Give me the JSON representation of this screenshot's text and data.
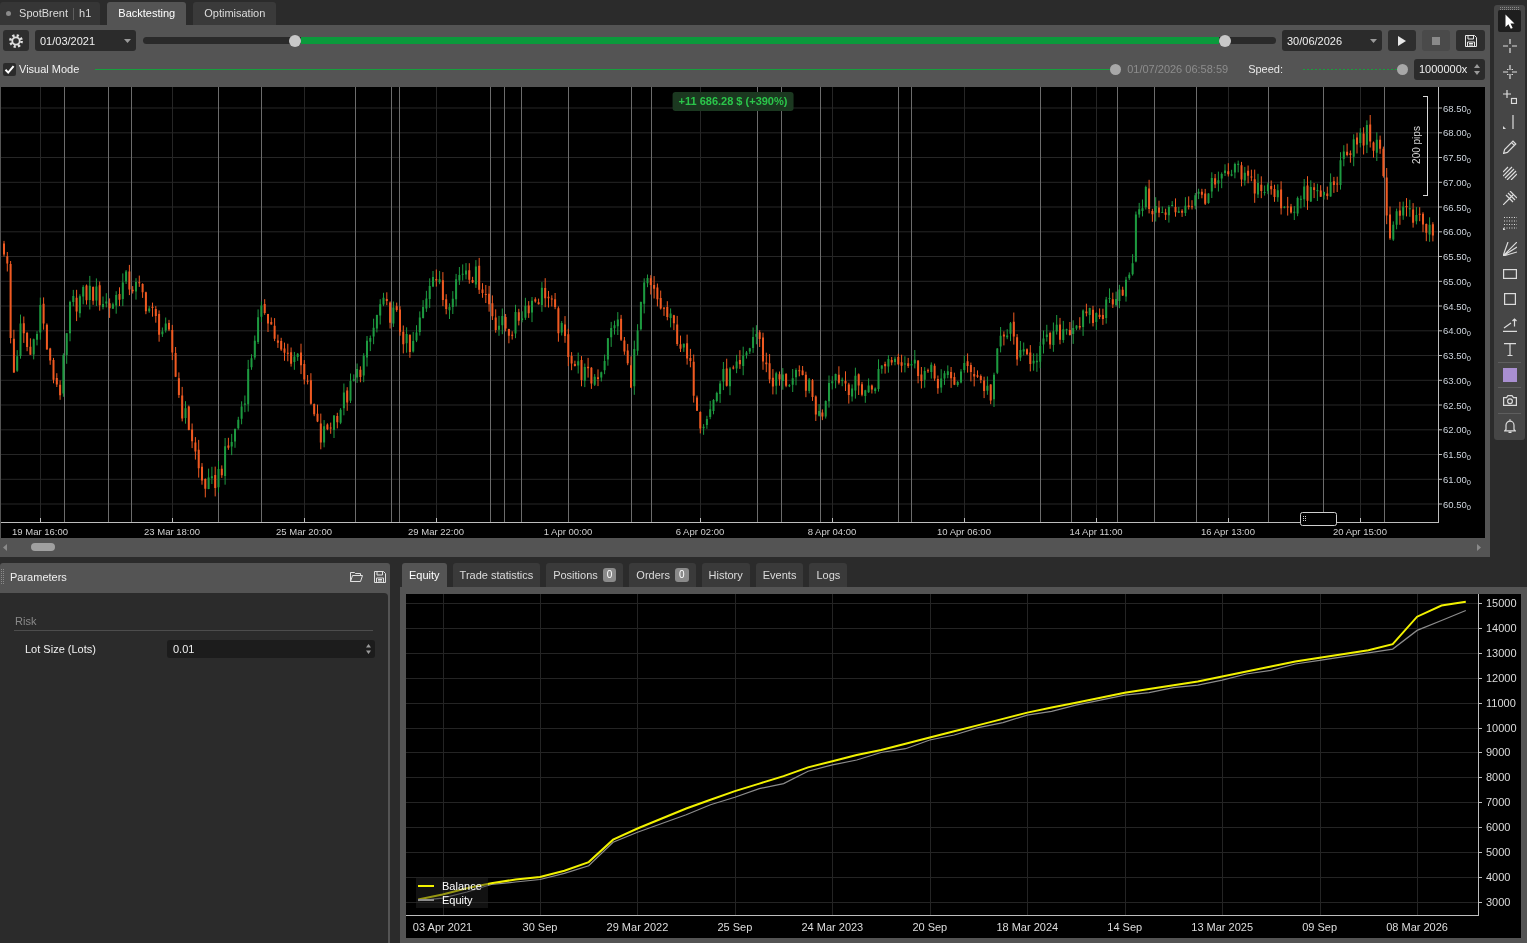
{
  "symbol_tab": {
    "symbol": "SpotBrent",
    "timeframe": "h1"
  },
  "mode_tabs": [
    {
      "label": "Backtesting",
      "selected": true
    },
    {
      "label": "Optimisation",
      "selected": false
    }
  ],
  "period": {
    "start_date": "01/03/2021",
    "end_date": "30/06/2026",
    "start": {
      "level": 0.134
    },
    "end": {
      "level": 0.955
    }
  },
  "playback_buttons": [
    {
      "kind": "play",
      "disabled": false
    },
    {
      "kind": "stop",
      "disabled": true
    },
    {
      "kind": "save",
      "disabled": false
    }
  ],
  "visual_mode": {
    "label": "Visual Mode",
    "checked": true
  },
  "progress": {
    "level": 1,
    "time": "01/07/2026 06:58:59"
  },
  "speed": {
    "label": "Speed:",
    "level": 1,
    "value": "1000000x"
  },
  "price_chart": {
    "profit": "+11 686.28 $ (+390%)",
    "ruler": "200 pips",
    "price_labels": [
      "68.50$_{0}$",
      "68.00$_{0}$",
      "67.50$_{0}$",
      "67.00$_{0}$",
      "66.50$_{0}$",
      "66.00$_{0}$",
      "65.50$_{0}$",
      "65.00$_{0}$",
      "64.50$_{0}$",
      "64.00$_{0}$",
      "63.50$_{0}$",
      "63.00$_{0}$",
      "62.50$_{0}$",
      "62.00$_{0}$",
      "61.50$_{0}$",
      "61.00$_{0}$",
      "60.50$_{0}$"
    ],
    "time_labels": [
      "19 Mar 16:00",
      "23 Mar 18:00",
      "25 Mar 20:00",
      "29 Mar 22:00",
      "1 Apr 00:00",
      "6 Apr 02:00",
      "8 Apr 04:00",
      "10 Apr 06:00",
      "14 Apr 11:00",
      "16 Apr 13:00",
      "20 Apr 15:00"
    ]
  },
  "tool_groups": [
    {
      "tools": [
        {
          "kind": "pointer",
          "selected": true
        },
        {
          "kind": "crosshair",
          "selected": false
        },
        {
          "kind": "target",
          "selected": false
        },
        {
          "kind": "hline",
          "selected": false
        },
        {
          "kind": "vline",
          "selected": false
        },
        {
          "kind": "pencil",
          "selected": false
        },
        {
          "kind": "brush",
          "selected": false
        },
        {
          "kind": "pitchfork",
          "selected": false
        },
        {
          "kind": "fibonacci",
          "selected": false
        },
        {
          "kind": "fan",
          "selected": false
        },
        {
          "kind": "rectangle",
          "selected": false
        },
        {
          "kind": "square",
          "selected": false
        },
        {
          "kind": "measure",
          "selected": false
        },
        {
          "kind": "text",
          "selected": false
        }
      ]
    },
    {
      "tools": [
        {
          "kind": "color",
          "color": "#a98fd1",
          "selected": false
        }
      ]
    },
    {
      "tools": [
        {
          "kind": "camera",
          "selected": false
        }
      ]
    },
    {
      "tools": [
        {
          "kind": "alert",
          "selected": false
        }
      ]
    }
  ],
  "parameters": {
    "title": "Parameters",
    "groups": [
      {
        "name": "Risk",
        "fields": [
          {
            "label": "Lot Size (Lots)",
            "value": "0.01"
          }
        ]
      }
    ]
  },
  "result_tabs": [
    {
      "label": "Equity",
      "selected": true
    },
    {
      "label": "Trade statistics",
      "selected": false
    },
    {
      "label": "Positions",
      "count": "0",
      "selected": false
    },
    {
      "label": "Orders",
      "count": "0",
      "selected": false
    },
    {
      "label": "History",
      "selected": false
    },
    {
      "label": "Events",
      "selected": false
    },
    {
      "label": "Logs",
      "selected": false
    }
  ],
  "equity_chart": {
    "chart_data": {
      "type": "line",
      "grid": true,
      "legend": "lower left",
      "categories": [
        null,
        "03 Apr 2021",
        null,
        null,
        null,
        "30 Sep",
        null,
        null,
        null,
        "29 Mar 2022",
        null,
        null,
        null,
        "25 Sep",
        null,
        null,
        null,
        "24 Mar 2023",
        null,
        null,
        null,
        "20 Sep",
        null,
        null,
        null,
        "18 Mar 2024",
        null,
        null,
        null,
        "14 Sep",
        null,
        null,
        null,
        "13 Mar 2025",
        null,
        null,
        null,
        "09 Sep",
        null,
        null,
        null,
        "08 Mar 2026",
        null,
        null
      ],
      "ylim": [
        2476,
        15362
      ],
      "yticks": [
        15000,
        14000,
        13000,
        12000,
        11000,
        10000,
        9000,
        8000,
        7000,
        6000,
        5000,
        4000,
        3000
      ],
      "series": [
        {
          "name": "Balance",
          "color": "#f2f200",
          "values": [
            3100,
            3300,
            3550,
            3750,
            3900,
            4000,
            4250,
            4600,
            5500,
            5950,
            6350,
            6750,
            7100,
            7450,
            7750,
            8050,
            8400,
            8650,
            8900,
            9100,
            9350,
            9600,
            9850,
            10100,
            10350,
            10600,
            10800,
            11000,
            11200,
            11400,
            11550,
            11700,
            11850,
            12050,
            12250,
            12450,
            12650,
            12800,
            12950,
            13100,
            13350,
            14450,
            14900,
            15050
          ]
        },
        {
          "name": "Equity",
          "color": "#8c8c8c",
          "values": [
            3050,
            3150,
            3400,
            3700,
            3800,
            3900,
            4150,
            4450,
            5400,
            5800,
            6150,
            6500,
            6900,
            7200,
            7550,
            7750,
            8250,
            8500,
            8700,
            9000,
            9150,
            9500,
            9700,
            10000,
            10200,
            10500,
            10650,
            10900,
            11100,
            11300,
            11400,
            11600,
            11700,
            11900,
            12150,
            12300,
            12550,
            12700,
            12850,
            13000,
            13150,
            13900,
            14300,
            14700
          ]
        }
      ]
    }
  }
}
